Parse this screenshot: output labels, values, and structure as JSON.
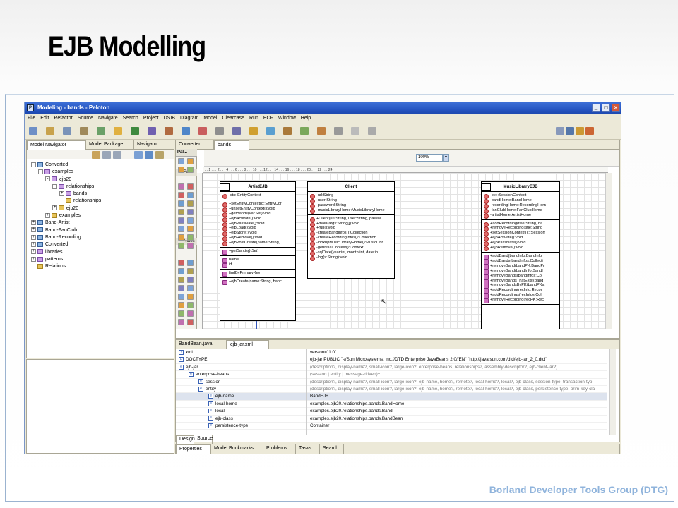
{
  "slide": {
    "title": "EJB Modelling",
    "footer": "Borland Developer Tools Group (DTG)"
  },
  "window": {
    "title": "Modeling - bands - Peloton",
    "app_icon": "P"
  },
  "menu": [
    "File",
    "Edit",
    "Refactor",
    "Source",
    "Navigate",
    "Search",
    "Project",
    "DSIB",
    "Diagram",
    "Model",
    "Clearcase",
    "Run",
    "ECF",
    "Window",
    "Help"
  ],
  "left_tabs": [
    "Model Navigator",
    "Model Package ...",
    "Navigator"
  ],
  "tree": [
    {
      "label": "Converted",
      "indent": 0,
      "exp": "-",
      "icon": "prj"
    },
    {
      "label": "examples",
      "indent": 1,
      "exp": "-",
      "icon": "pkg"
    },
    {
      "label": "ejb20",
      "indent": 2,
      "exp": "-",
      "icon": "pkg"
    },
    {
      "label": "relationships",
      "indent": 3,
      "exp": "-",
      "icon": "pkg"
    },
    {
      "label": "bands",
      "indent": 4,
      "exp": "+",
      "icon": "pkg"
    },
    {
      "label": "relationships",
      "indent": 4,
      "exp": "",
      "icon": "file"
    },
    {
      "label": "ejb20",
      "indent": 3,
      "exp": "+",
      "icon": "file"
    },
    {
      "label": "examples",
      "indent": 2,
      "exp": "+",
      "icon": "file"
    },
    {
      "label": "Band-Artist",
      "indent": 0,
      "exp": "+",
      "icon": "prj"
    },
    {
      "label": "Band-FanClub",
      "indent": 0,
      "exp": "+",
      "icon": "prj"
    },
    {
      "label": "Band-Recording",
      "indent": 0,
      "exp": "+",
      "icon": "prj"
    },
    {
      "label": "Converted",
      "indent": 0,
      "exp": "+",
      "icon": "prj"
    },
    {
      "label": "libraries",
      "indent": 0,
      "exp": "+",
      "icon": "pkg"
    },
    {
      "label": "patterns",
      "indent": 0,
      "exp": "+",
      "icon": "pkg"
    },
    {
      "label": "Relations",
      "indent": 0,
      "exp": "",
      "icon": "file"
    }
  ],
  "editor_tabs": [
    "Converted",
    "bands"
  ],
  "palette": {
    "header": "Pal...",
    "sub": "Pa...",
    "notes": "Notes"
  },
  "zoom": "100%",
  "ruler": ". . . 1 . . . 2 . . . 4 . . . 6 . . . 8 . . . 10 . . . 12 . . . 14 . . . 16 . . . 18 . . . 20 . . . 22 . . . 24",
  "artist": {
    "name": "ArtistEJB",
    "attrs": [
      "-ctx::EntityContext"
    ],
    "methods": [
      "+setEntityContext(c::EntityCor",
      "+unsetEntityContext():void",
      "+getBands(val:Set):void",
      "+ejbActivate():void",
      "+ejbPassivate():void",
      "+ejbLoad():void",
      "+ejbStore():void",
      "+ejbRemove():void",
      "+ejbPostCreate(name:String,"
    ],
    "getter": "+getBands():Set",
    "fields": [
      "name",
      "id"
    ],
    "finder": "findByPrimaryKey",
    "create": "+ejbCreate(name:String, banc"
  },
  "client": {
    "name": "Client",
    "attrs": [
      "-url:String",
      "-user:String",
      "-password:String",
      "-musicLibraryHome:MusicLibraryHome"
    ],
    "methods": [
      "+Client(url:String, user:String, passw",
      "+main(args:String[]):void",
      "+run():void",
      "-createBandInfos():Collection",
      "-createRecordingInfos():Collection",
      "-lookupMusicLibraryHome():MusicLibr",
      "-getInitialContext():Context",
      "-sqlDate(year:int, month:int, date:in",
      "-log(s:String):void"
    ]
  },
  "music": {
    "name": "MusicLibraryEJB",
    "attrs": [
      "-ctx::SessionContext",
      "-bandHome:BandHome",
      "-recordingHome:RecordingHom",
      "-fanClubHome:FanClubHome",
      "-artistHome:ArtistHome"
    ],
    "methods": [
      "+addRecording(title:String, ba",
      "+removeRecording(title:String",
      "+setSessionContext(c::Session",
      "+ejbActivate():void",
      "+ejbPassivate():void",
      "+ejbRemove():void"
    ],
    "methods2": [
      "+addBand(bandInfo:BandInfo",
      "+addBands(bandInfos:Collecti",
      "+removeBand(bandPK:BandPr",
      "+removeBand(bandInfo:BandI",
      "+removeBands(bandInfos:Col",
      "+removeBandsThatExist(band",
      "+removeBandsByPK(bandPKs:",
      "+addRecording(recInfo:Recor",
      "+addRecordings(recInfos:Coll",
      "+removeRecording(recPK:Rec"
    ]
  },
  "xml_tabs": [
    "BandBean.java",
    "ejb-jar.xml"
  ],
  "xml": [
    {
      "name": "xml",
      "value": "version=\"1.0\"",
      "indent": 0,
      "type": "pi",
      "gray": false
    },
    {
      "name": "DOCTYPE",
      "value": "ejb-jar PUBLIC \"-//Sun Microsystems, Inc.//DTD Enterprise JavaBeans 2.0//EN\" \"http://java.sun.com/dtd/ejb-jar_2_0.dtd\"",
      "indent": 0,
      "type": "doc",
      "gray": false
    },
    {
      "name": "ejb-jar",
      "value": "(description?, display-name?, small-icon?, large-icon?, enterprise-beans, relationships?, assembly-descriptor?, ejb-client-jar?)",
      "indent": 0,
      "type": "e",
      "gray": true
    },
    {
      "name": "enterprise-beans",
      "value": "(session | entity | message-driven)+",
      "indent": 1,
      "type": "e",
      "gray": true
    },
    {
      "name": "session",
      "value": "(description?, display-name?, small-icon?, large-icon?, ejb-name, home?, remote?, local-home?, local?, ejb-class, session-type, transaction-typ",
      "indent": 2,
      "type": "e",
      "gray": true
    },
    {
      "name": "entity",
      "value": "(description?, display-name?, small-icon?, large-icon?, ejb-name, home?, remote?, local-home?, local?, ejb-class, persistence-type, prim-key-cla",
      "indent": 2,
      "type": "e",
      "gray": true
    },
    {
      "name": "ejb-name",
      "value": "BandEJB",
      "indent": 3,
      "type": "e",
      "gray": false
    },
    {
      "name": "local-home",
      "value": "examples.ejb20.relationships.bands.BandHome",
      "indent": 3,
      "type": "e",
      "gray": false
    },
    {
      "name": "local",
      "value": "examples.ejb20.relationships.bands.Band",
      "indent": 3,
      "type": "e",
      "gray": false
    },
    {
      "name": "ejb-class",
      "value": "examples.ejb20.relationships.bands.BandBean",
      "indent": 3,
      "type": "e",
      "gray": false
    },
    {
      "name": "persistence-type",
      "value": "Container",
      "indent": 3,
      "type": "e",
      "gray": false
    }
  ],
  "design_tabs": [
    "Design",
    "Source"
  ],
  "bottom_tabs": [
    "Properties",
    "Model Bookmarks",
    "Problems",
    "Tasks",
    "Search"
  ]
}
